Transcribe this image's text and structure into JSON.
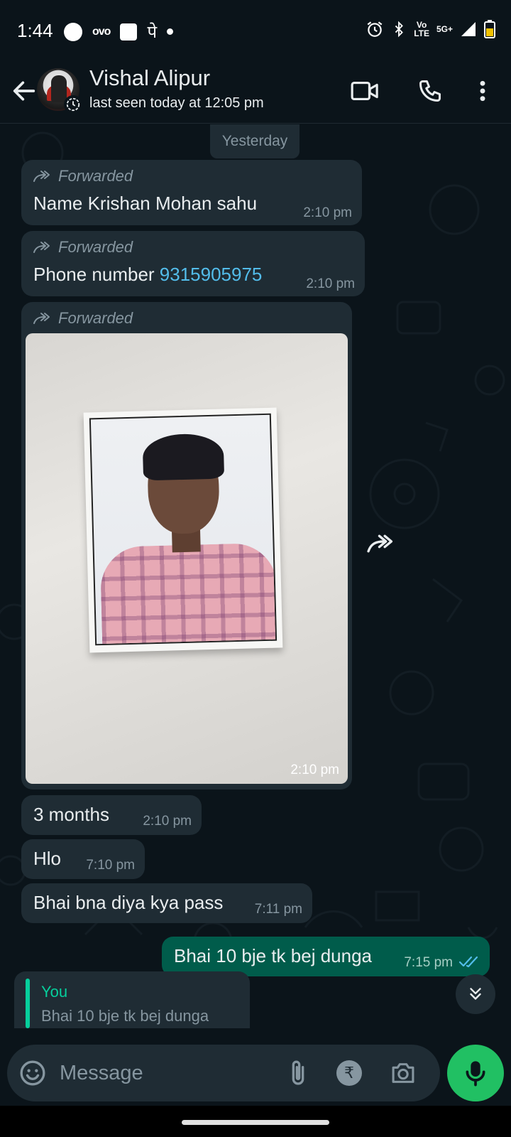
{
  "status_bar": {
    "time": "1:44",
    "ovo": "ovo",
    "pe": "पे",
    "volte_top": "Vo",
    "volte_bottom": "LTE",
    "network": "5G+"
  },
  "header": {
    "contact_name": "Vishal Alipur",
    "last_seen": "last seen today at 12:05 pm",
    "icons": [
      "back-arrow-icon",
      "video-call-icon",
      "voice-call-icon",
      "more-options-icon"
    ]
  },
  "chat": {
    "date_chip": "Yesterday",
    "forwarded_label": "Forwarded",
    "messages": [
      {
        "text": "Name  Krishan Mohan sahu",
        "time": "2:10 pm",
        "forwarded": true
      },
      {
        "prefix": "Phone number ",
        "link": "9315905975",
        "time": "2:10 pm",
        "forwarded": true
      },
      {
        "type": "image",
        "time": "2:10 pm",
        "forwarded": true
      },
      {
        "text": "3 months",
        "time": "2:10 pm"
      },
      {
        "text": "Hlo",
        "time": "7:10 pm"
      },
      {
        "text": "Bhai bna diya kya pass",
        "time": "7:11 pm"
      },
      {
        "text": "Bhai 10 bje tk bej dunga",
        "time": "7:15 pm",
        "outgoing": true,
        "status": "read"
      }
    ],
    "quoted": {
      "author": "You",
      "text": "Bhai 10 bje tk bej dunga"
    }
  },
  "composer": {
    "placeholder": "Message",
    "rupee": "₹"
  },
  "colors": {
    "background": "#0b141a",
    "incoming_bubble": "#1f2c34",
    "outgoing_bubble": "#005c4b",
    "accent_green": "#21c063",
    "link_blue": "#53bdeb",
    "read_tick": "#53bdeb"
  }
}
